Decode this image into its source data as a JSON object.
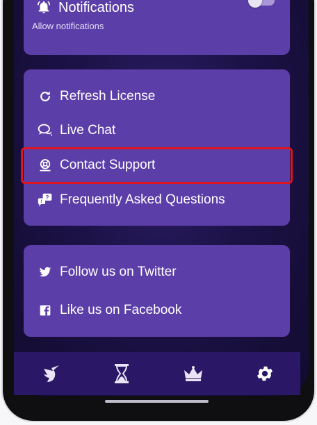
{
  "notifications": {
    "title": "Notifications",
    "subtitle": "Allow notifications",
    "enabled": false,
    "icon": "bell-icon"
  },
  "support": {
    "items": [
      {
        "label": "Refresh License",
        "icon": "refresh-icon"
      },
      {
        "label": "Live Chat",
        "icon": "chat-icon"
      },
      {
        "label": "Contact Support",
        "icon": "lifebuoy-icon"
      },
      {
        "label": "Frequently Asked Questions",
        "icon": "faq-icon"
      }
    ]
  },
  "social": {
    "items": [
      {
        "label": "Follow us on Twitter",
        "icon": "twitter-icon"
      },
      {
        "label": "Like us on Facebook",
        "icon": "facebook-icon"
      }
    ]
  },
  "navbar": {
    "items": [
      {
        "name": "unicorn-icon",
        "active": false
      },
      {
        "name": "hourglass-icon",
        "active": false
      },
      {
        "name": "crown-icon",
        "active": false
      },
      {
        "name": "settings-gear-icon",
        "active": true
      }
    ]
  },
  "highlighted_item": "Contact Support",
  "colors": {
    "card": "#5c3ea8",
    "background": "#1c1247",
    "navbar": "#2a1766",
    "highlight": "#e0141e"
  }
}
